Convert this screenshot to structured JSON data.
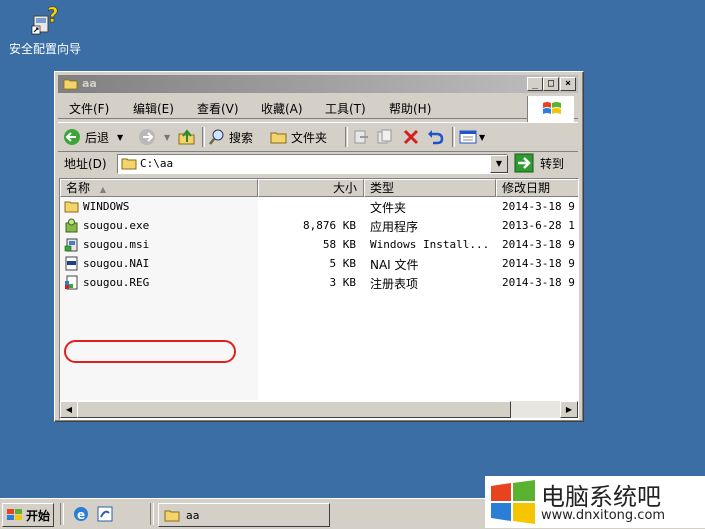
{
  "desktop": {
    "icon_label": "安全配置向导"
  },
  "window": {
    "title": "aa",
    "caption_buttons": [
      "_",
      "□",
      "×"
    ],
    "menu": [
      "文件(F)",
      "编辑(E)",
      "查看(V)",
      "收藏(A)",
      "工具(T)",
      "帮助(H)"
    ],
    "toolbar": {
      "back": "后退",
      "search": "搜索",
      "folders": "文件夹"
    },
    "address": {
      "label": "地址(D)",
      "value": "C:\\aa",
      "go": "转到"
    },
    "columns": {
      "name": "名称",
      "size": "大小",
      "type": "类型",
      "modified": "修改日期"
    },
    "files": [
      {
        "name": "WINDOWS",
        "size": "",
        "type": "文件夹",
        "modified": "2014-3-18 9",
        "icon": "folder-icon"
      },
      {
        "name": "sougou.exe",
        "size": "8,876 KB",
        "type": "应用程序",
        "modified": "2013-6-28 1",
        "icon": "exe-icon"
      },
      {
        "name": "sougou.msi",
        "size": "58 KB",
        "type": "Windows Install...",
        "modified": "2014-3-18 9",
        "icon": "msi-icon"
      },
      {
        "name": "sougou.NAI",
        "size": "5 KB",
        "type": "NAI 文件",
        "modified": "2014-3-18 9",
        "icon": "nai-file-icon"
      },
      {
        "name": "sougou.REG",
        "size": "3 KB",
        "type": "注册表项",
        "modified": "2014-3-18 9",
        "icon": "reg-file-icon"
      }
    ],
    "highlighted_file": "sougou.msi",
    "annotation_color": "#e02020"
  },
  "taskbar": {
    "start": "开始",
    "window_button": "aa"
  },
  "watermark": {
    "title": "电脑系统吧",
    "url": "www.dnxitong.com"
  }
}
